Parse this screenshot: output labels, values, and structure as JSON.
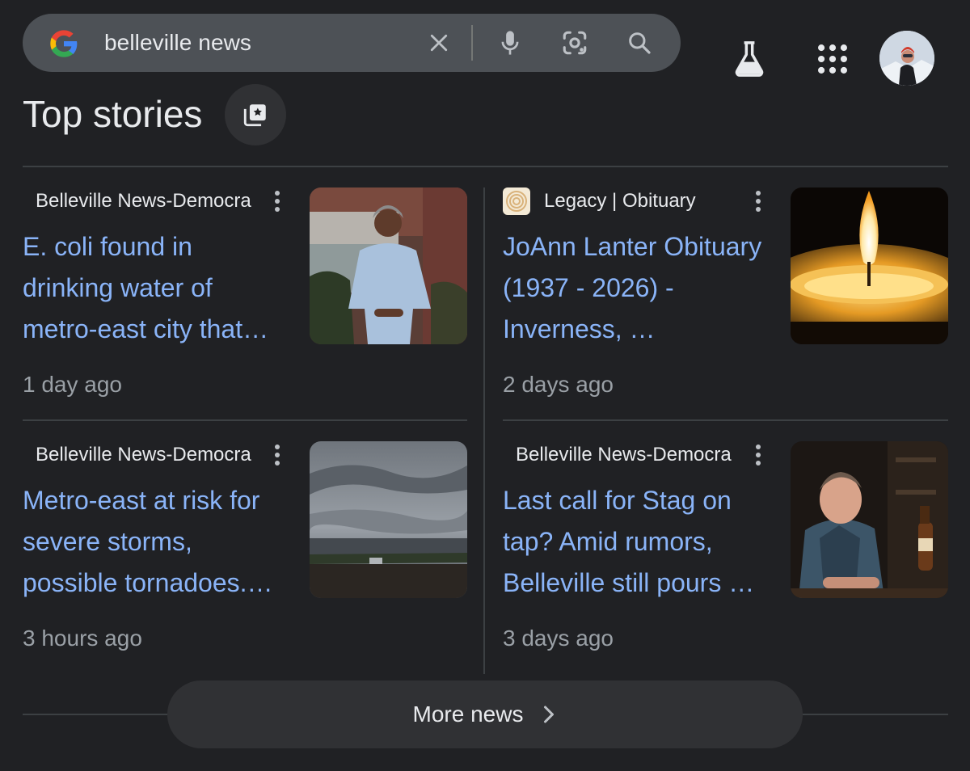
{
  "search": {
    "query": "belleville news"
  },
  "section": {
    "title": "Top stories"
  },
  "stories": [
    {
      "source": "Belleville News-Democra",
      "headline": "E. coli found in drinking water of metro-east city that…",
      "time": "1 day ago"
    },
    {
      "source": "Legacy | Obituary",
      "headline": "JoAnn Lanter Obituary (1937 - 2026) - Inverness, …",
      "time": "2 days ago"
    },
    {
      "source": "Belleville News-Democra",
      "headline": "Metro-east at risk for severe storms, possible tornadoes.…",
      "time": "3 hours ago"
    },
    {
      "source": "Belleville News-Democra",
      "headline": "Last call for Stag on tap? Amid rumors, Belleville still pours …",
      "time": "3 days ago"
    }
  ],
  "more": {
    "label": "More news"
  },
  "icons": {
    "clear": "close-icon",
    "voice": "microphone-icon",
    "lens": "camera-lens-icon",
    "search": "search-icon",
    "labs": "flask-icon",
    "apps": "apps-grid-icon",
    "chevron": "chevron-right-icon"
  },
  "colors": {
    "background": "#202124",
    "link": "#8ab4f8",
    "muted": "#9aa0a6"
  }
}
